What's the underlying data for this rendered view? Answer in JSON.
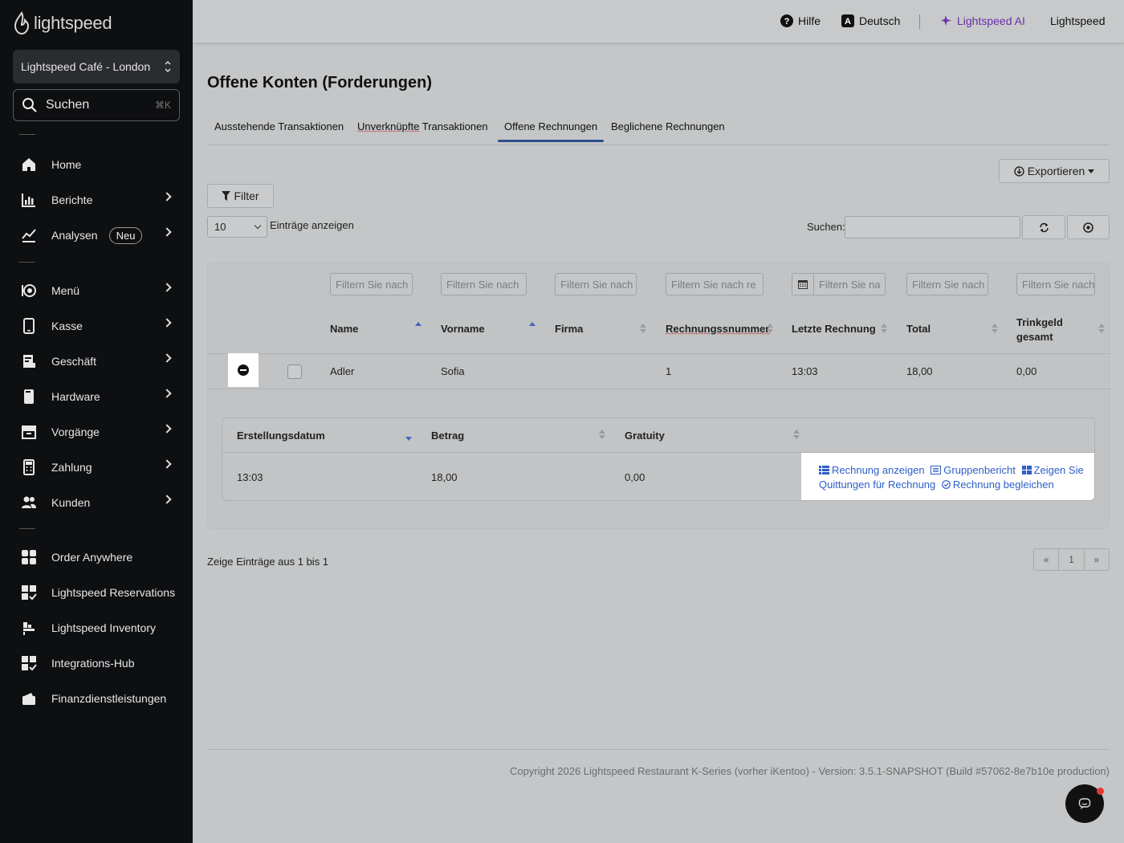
{
  "sidebar": {
    "brand": "lightspeed",
    "store": "Lightspeed Café - London",
    "search": {
      "label": "Suchen",
      "shortcut": "⌘K"
    },
    "items": [
      {
        "label": "Home",
        "icon": "home-icon"
      },
      {
        "label": "Berichte",
        "icon": "bar-chart-icon"
      },
      {
        "label": "Analysen",
        "icon": "trend-icon",
        "badge": "Neu"
      },
      {
        "label": "Menü",
        "icon": "menu-icon"
      },
      {
        "label": "Kasse",
        "icon": "tablet-icon"
      },
      {
        "label": "Geschäft",
        "icon": "store-icon"
      },
      {
        "label": "Hardware",
        "icon": "device-icon"
      },
      {
        "label": "Vorgänge",
        "icon": "archive-icon"
      },
      {
        "label": "Zahlung",
        "icon": "calculator-icon"
      },
      {
        "label": "Kunden",
        "icon": "users-icon"
      },
      {
        "label": "Order Anywhere",
        "icon": "grid-icon"
      },
      {
        "label": "Lightspeed Reservations",
        "icon": "apps-check-icon"
      },
      {
        "label": "Lightspeed Inventory",
        "icon": "inventory-icon"
      },
      {
        "label": "Integrations-Hub",
        "icon": "apps-check-icon"
      },
      {
        "label": "Finanzdienstleistungen",
        "icon": "wallet-icon"
      }
    ]
  },
  "header": {
    "help": "Hilfe",
    "language": "Deutsch",
    "ai": "Lightspeed AI",
    "user": "Lightspeed",
    "ai_color": "#6b2fa8"
  },
  "page": {
    "title": "Offene Konten (Forderungen)",
    "tabs": [
      "Ausstehende Transaktionen",
      "Unverknüpfte Transaktionen",
      "Offene Rechnungen",
      "Beglichene Rechnungen"
    ],
    "active_tab": 2,
    "export_label": "Exportieren",
    "filter_label": "Filter",
    "page_length": "10",
    "page_length_label": "Einträge anzeigen",
    "search_label": "Suchen:"
  },
  "table": {
    "filter_placeholders": [
      "Filtern Sie nach",
      "Filtern Sie nach",
      "Filtern Sie nach",
      "Filtern Sie nach re",
      "Filtern Sie na",
      "Filtern Sie nach",
      "Filtern Sie nach"
    ],
    "columns": [
      "Name",
      "Vorname",
      "Firma",
      "Rechnungssnummer",
      "Letzte Rechnung",
      "Total",
      "Trinkgeld gesamt"
    ],
    "rows": [
      {
        "name": "Adler",
        "vorname": "Sofia",
        "firma": "",
        "rechnungsnummer": "1",
        "letzte": "13:03",
        "total": "18,00",
        "trinkgeld": "0,00"
      }
    ],
    "detail": {
      "columns": [
        "Erstellungsdatum",
        "Betrag",
        "Gratuity"
      ],
      "row": {
        "datum": "13:03",
        "betrag": "18,00",
        "gratuity": "0,00"
      },
      "actions": [
        "Rechnung anzeigen",
        "Gruppenbericht",
        "Zeigen Sie Quittungen für Rechnung",
        "Rechnung begleichen"
      ]
    },
    "info": "Zeige Einträge aus 1 bis 1",
    "pager": {
      "prev": "«",
      "page": "1",
      "next": "»"
    }
  },
  "footer": {
    "copyright": "Copyright 2026 Lightspeed Restaurant K-Series (vorher iKentoo) - Version: 3.5.1-SNAPSHOT (Build #57062-8e7b10e production)"
  },
  "colors": {
    "link": "#2e5ec6",
    "sort_active": "#4a61c6",
    "tab_underline": "#2c4f8c"
  }
}
